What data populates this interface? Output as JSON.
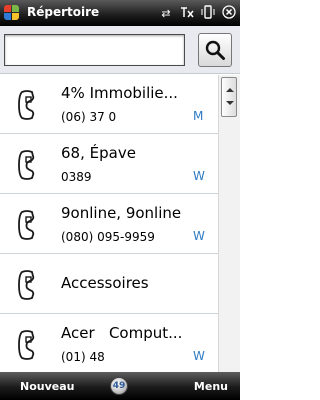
{
  "titlebar": {
    "title": "Répertoire",
    "status_icons": [
      "sync-arrows-icon",
      "signal-off-icon",
      "vibrate-icon",
      "close-icon"
    ]
  },
  "search": {
    "value": "",
    "placeholder": "",
    "button_icon": "magnifier-icon"
  },
  "contacts": [
    {
      "name": "4% Immobilie...",
      "number": "(06) 37 0",
      "tag": "M"
    },
    {
      "name": "68, Épave",
      "number": "0389",
      "tag": "W"
    },
    {
      "name": "9online, 9online",
      "number": "(080) 095-9959",
      "tag": "W"
    },
    {
      "name": "Accessoires",
      "number": "",
      "tag": ""
    },
    {
      "name": "Acer   Comput...",
      "number": "(01) 48",
      "tag": "W"
    }
  ],
  "softkeys": {
    "left": "Nouveau",
    "center": "49",
    "right": "Menu"
  },
  "colors": {
    "tag_blue": "#2f7bc4",
    "bar_dark": "#000000"
  }
}
